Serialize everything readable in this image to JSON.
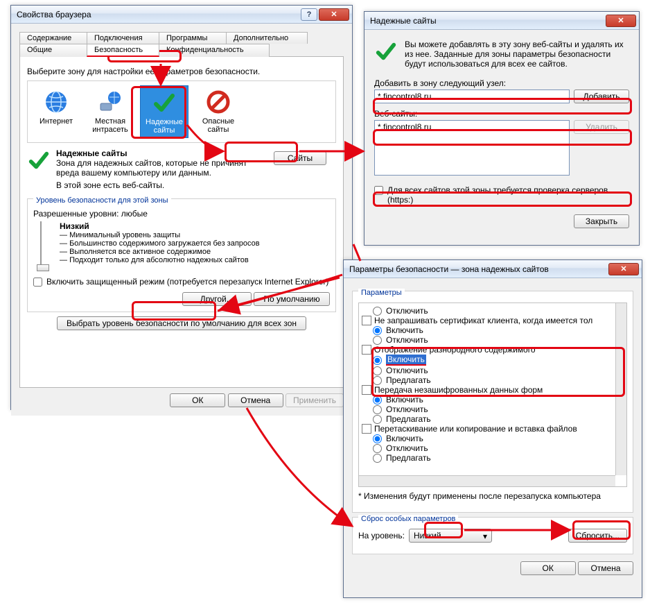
{
  "browserProps": {
    "title": "Свойства браузера",
    "tabsTop": {
      "t1": "Содержание",
      "t2": "Подключения",
      "t3": "Программы",
      "t4": "Дополнительно"
    },
    "tabsBottom": {
      "t1": "Общие",
      "t2": "Безопасность",
      "t3": "Конфиденциальность"
    },
    "selectZoneLabel": "Выберите зону для настройки ее параметров безопасности.",
    "zones": {
      "internet": "Интернет",
      "intranet": "Местная интрасеть",
      "trusted": "Надежные сайты",
      "restricted": "Опасные сайты"
    },
    "trustedHeader": "Надежные сайты",
    "trustedDesc1": "Зона для надежных сайтов, которые не причинят вреда вашему компьютеру или данным.",
    "trustedDesc2": "В этой зоне есть веб-сайты.",
    "sitesBtn": "Сайты",
    "secLevelGroup": "Уровень безопасности для этой зоны",
    "allowedLevels": "Разрешенные уровни: любые",
    "levelName": "Низкий",
    "bullets": {
      "b1": "Минимальный уровень защиты",
      "b2": "Большинство содержимого загружается без запросов",
      "b3": "Выполняется все активное содержимое",
      "b4": "Подходит только для абсолютно надежных сайтов"
    },
    "protectedMode": "Включить защищенный режим (потребуется перезапуск Internet Explorer)",
    "customBtn": "Другой...",
    "defaultBtn": "По умолчанию",
    "resetAllBtn": "Выбрать уровень безопасности по умолчанию для всех зон",
    "ok": "ОК",
    "cancel": "Отмена",
    "apply": "Применить"
  },
  "trustedSites": {
    "title": "Надежные сайты",
    "info": "Вы можете добавлять в эту зону  веб-сайты и удалять их из нее. Заданные для зоны параметры безопасности будут использоваться для всех ее сайтов.",
    "addLabel": "Добавить в зону следующий узел:",
    "addValue": "*.fincontrol8.ru",
    "addBtn": "Добавить",
    "listLabel": "Веб-сайты:",
    "listItem": "*.fincontrol8.ru",
    "removeBtn": "Удалить",
    "httpsCheck": "Для всех сайтов этой зоны требуется проверка серверов (https:)",
    "closeBtn": "Закрыть"
  },
  "secParams": {
    "title": "Параметры безопасности — зона надежных сайтов",
    "paramsGroup": "Параметры",
    "options": {
      "disable": "Отключить",
      "noAskCert": "Не запрашивать сертификат клиента, когда имеется тол",
      "enable": "Включить",
      "mixedContent": "Отображение разнородного содержимого",
      "prompt": "Предлагать",
      "unencForms": "Передача незашифрованных данных форм",
      "dragDrop": "Перетаскивание или копирование и вставка файлов"
    },
    "restartNote": "* Изменения будут применены после перезапуска компьютера",
    "resetGroup": "Сброс особых параметров",
    "toLevel": "На уровень:",
    "levelValue": "Низкий",
    "resetBtn": "Сбросить...",
    "ok": "ОК",
    "cancel": "Отмена"
  }
}
